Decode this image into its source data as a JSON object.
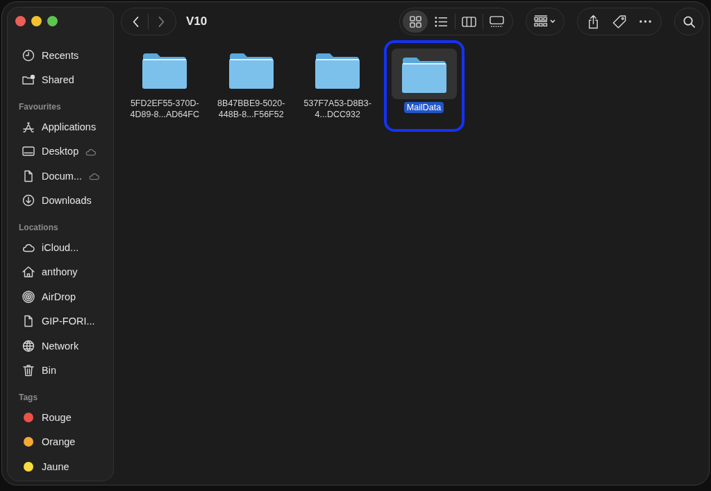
{
  "window": {
    "title": "V10"
  },
  "sidebar": {
    "sections": [
      {
        "items": [
          {
            "label": "Recents",
            "in_icloud": false
          },
          {
            "label": "Shared",
            "in_icloud": false
          }
        ]
      },
      {
        "heading": "Favourites",
        "items": [
          {
            "label": "Applications",
            "in_icloud": false
          },
          {
            "label": "Desktop",
            "in_icloud": true
          },
          {
            "label": "Docum...",
            "in_icloud": true
          },
          {
            "label": "Downloads",
            "in_icloud": false
          }
        ]
      },
      {
        "heading": "Locations",
        "items": [
          {
            "label": "iCloud...",
            "in_icloud": false
          },
          {
            "label": "anthony",
            "in_icloud": false
          },
          {
            "label": "AirDrop",
            "in_icloud": false
          },
          {
            "label": "GIP-FORI...",
            "in_icloud": false
          },
          {
            "label": "Network",
            "in_icloud": false
          },
          {
            "label": "Bin",
            "in_icloud": false
          }
        ]
      },
      {
        "heading": "Tags",
        "items": [
          {
            "label": "Rouge",
            "color": "#ec5148"
          },
          {
            "label": "Orange",
            "color": "#f5a833"
          },
          {
            "label": "Jaune",
            "color": "#f7dc3c"
          }
        ]
      }
    ]
  },
  "view_modes": [
    {
      "selected": true
    },
    {
      "selected": false
    },
    {
      "selected": false
    },
    {
      "selected": false
    }
  ],
  "folders": [
    {
      "name": "5FD2EF55-370D-4D89-8...AD64FC",
      "selected": false
    },
    {
      "name": "8B47BBE9-5020-448B-8...F56F52",
      "selected": false
    },
    {
      "name": "537F7A53-D8B3-4...DCC932",
      "selected": false
    },
    {
      "name": "MailData",
      "selected": true
    }
  ]
}
